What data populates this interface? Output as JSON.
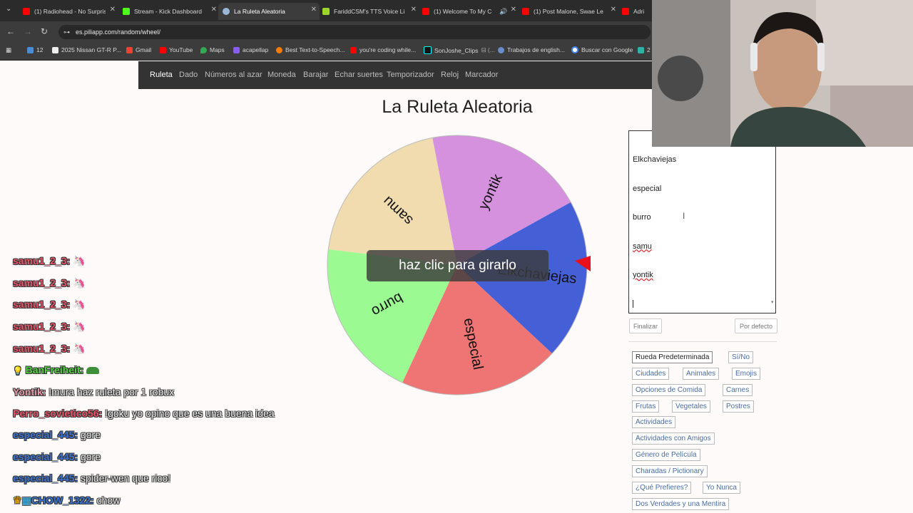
{
  "tabs": [
    {
      "title": "(1) Radiohead - No Surprises",
      "icon": "youtube-icon",
      "color": "#ff0000"
    },
    {
      "title": "Stream - Kick Dashboard",
      "icon": "kick-icon",
      "color": "#53fc18"
    },
    {
      "title": "La Ruleta Aleatoria",
      "icon": "piliapp-icon",
      "color": "#9ab7d8",
      "active": true
    },
    {
      "title": "FariddCSM's TTS Voice Li",
      "icon": "tts-icon",
      "color": "#9bd52e"
    },
    {
      "title": "(1) Welcome To My C",
      "icon": "youtube-icon",
      "color": "#ff0000"
    },
    {
      "title": "(1) Post Malone, Swae Le",
      "icon": "youtube-icon",
      "color": "#ff0000"
    },
    {
      "title": "Adri",
      "icon": "youtube-icon",
      "color": "#ff0000"
    }
  ],
  "address": {
    "url": "es.piliapp.com/random/wheel/"
  },
  "bookmarks": [
    {
      "label": "12",
      "icon": "list-icon"
    },
    {
      "label": "2025 Nissan GT-R P...",
      "icon": "w-icon"
    },
    {
      "label": "Gmail",
      "icon": "gmail-icon"
    },
    {
      "label": "YouTube",
      "icon": "youtube-icon"
    },
    {
      "label": "Maps",
      "icon": "maps-icon"
    },
    {
      "label": "acapellap",
      "icon": "wave-icon"
    },
    {
      "label": "Best Text-to-Speech...",
      "icon": "ai-icon"
    },
    {
      "label": "you're coding while...",
      "icon": "youtube-icon"
    },
    {
      "label": "SonJoshe_Clips",
      "icon": "tiktok-icon"
    },
    {
      "label": "Trabajos de english...",
      "icon": "globe-icon"
    },
    {
      "label": "Buscar con Google",
      "icon": "google-icon"
    },
    {
      "label": "2",
      "icon": "other-icon"
    }
  ],
  "site_nav": [
    {
      "label": "Ruleta",
      "active": true
    },
    {
      "label": "Dado"
    },
    {
      "label": "Números al azar"
    },
    {
      "label": "Moneda"
    },
    {
      "label": "Barajar"
    },
    {
      "label": "Echar suertes"
    },
    {
      "label": "Temporizador"
    },
    {
      "label": "Reloj"
    },
    {
      "label": "Marcador"
    }
  ],
  "page_title": "La Ruleta Aleatoria",
  "wheel": {
    "spin_label": "haz clic para girarlo",
    "segments": [
      {
        "label": "Elkchaviejas",
        "color": "#4560d6"
      },
      {
        "label": "especial",
        "color": "#ef7474"
      },
      {
        "label": "burro",
        "color": "#9cfa92"
      },
      {
        "label": "samu",
        "color": "#f0dcae"
      },
      {
        "label": "yontik",
        "color": "#d591dd"
      }
    ],
    "pointer_color": "#e8101a"
  },
  "editor": {
    "lines": [
      "Elkchaviejas",
      "especial",
      "burro",
      "samu",
      "yontik"
    ],
    "finish_label": "Finalizar",
    "default_label": "Por defecto"
  },
  "presets": [
    {
      "label": "Rueda Predeterminada",
      "selected": true
    },
    {
      "label": "Sí/No"
    },
    {
      "label": "Ciudades"
    },
    {
      "label": "Animales"
    },
    {
      "label": "Emojis"
    },
    {
      "label": "Opciones de Comida"
    },
    {
      "label": "Carnes"
    },
    {
      "label": "Frutas"
    },
    {
      "label": "Vegetales"
    },
    {
      "label": "Postres"
    },
    {
      "label": "Actividades"
    },
    {
      "label": "Actividades con Amigos"
    },
    {
      "label": "Género de Película"
    },
    {
      "label": "Charadas / Pictionary"
    },
    {
      "label": "¿Qué Prefieres?"
    },
    {
      "label": "Yo Nunca"
    },
    {
      "label": "Dos Verdades y una Mentira"
    }
  ],
  "chat": [
    {
      "user": "samu1_2_3:",
      "msg": "",
      "color": "#e8536a",
      "emote": "unicorn-icon"
    },
    {
      "user": "samu1_2_3:",
      "msg": "",
      "color": "#e8536a",
      "emote": "unicorn-icon"
    },
    {
      "user": "samu1_2_3:",
      "msg": "",
      "color": "#e8536a",
      "emote": "unicorn-icon"
    },
    {
      "user": "samu1_2_3:",
      "msg": "",
      "color": "#e8536a",
      "emote": "unicorn-icon"
    },
    {
      "user": "samu1_2_3:",
      "msg": "",
      "color": "#e8536a",
      "emote": "unicorn-icon"
    },
    {
      "user": "BanFreiheit:",
      "msg": "",
      "color": "#51d23f",
      "emote": "frog-icon",
      "badge": "bulb-icon"
    },
    {
      "user": "Yontik:",
      "msg": "!mura haz ruleta por 1 robux",
      "color": "#e39aa6"
    },
    {
      "user": "Perro_sovietico56:",
      "msg": "!goku yo opino que es una buena idea",
      "color": "#e8536a"
    },
    {
      "user": "especial_445:",
      "msg": "gore",
      "color": "#3d74d4"
    },
    {
      "user": "especial_445:",
      "msg": "gore",
      "color": "#3d74d4"
    },
    {
      "user": "especial_445:",
      "msg": "spider-wen que rico!",
      "color": "#3d74d4"
    },
    {
      "user": "CHOW_1322:",
      "msg": "chow",
      "color": "#3d74d4",
      "badge": "crown-icon"
    }
  ],
  "webcam": {
    "label": ""
  }
}
